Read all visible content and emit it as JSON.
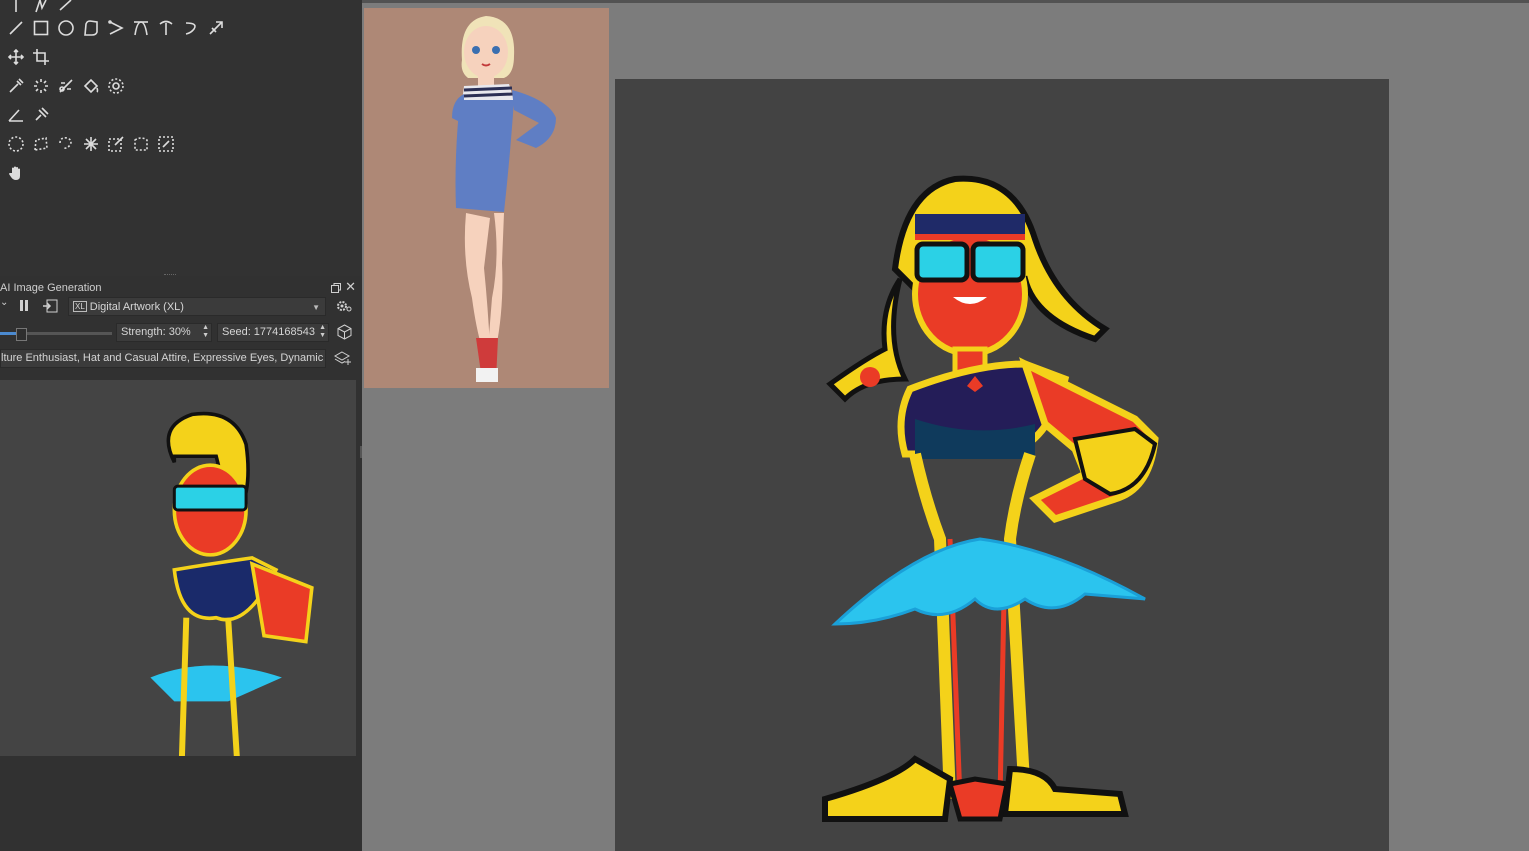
{
  "toolbox": {
    "rows": [
      [
        "freehand-brush",
        "brush-2",
        "brush-3"
      ],
      [
        "line",
        "rectangle",
        "ellipse",
        "polygon",
        "polyline",
        "bezier",
        "freehand-path",
        "dynamic-brush",
        "multibrush"
      ],
      [
        "move",
        "crop"
      ],
      [
        "color-picker",
        "smart-patch",
        "fill-multi",
        "fill",
        "enclose-fill"
      ],
      [
        "measure",
        "assistant"
      ],
      [
        "ellipse-select",
        "polygon-select",
        "freehand-select",
        "contiguous-select",
        "similar-select",
        "bezier-select",
        "magnetic-select"
      ],
      [
        "pan"
      ]
    ]
  },
  "ai_docker": {
    "title": "AI Image Generation",
    "style_value": "Digital Artwork (XL)",
    "style_badge": "XL",
    "strength_label": "Strength: 30%",
    "seed_label": "Seed: 1774168543",
    "prompt_text": "lture Enthusiast, Hat and Casual Attire, Expressive Eyes, Dynamic Pose,",
    "strength": 0.3
  },
  "colors": {
    "panel": "#323232",
    "canvas": "#434343",
    "workspace": "#7c7c7c",
    "reference_bg": "#ae8876",
    "accent": "#4b8ad0"
  }
}
